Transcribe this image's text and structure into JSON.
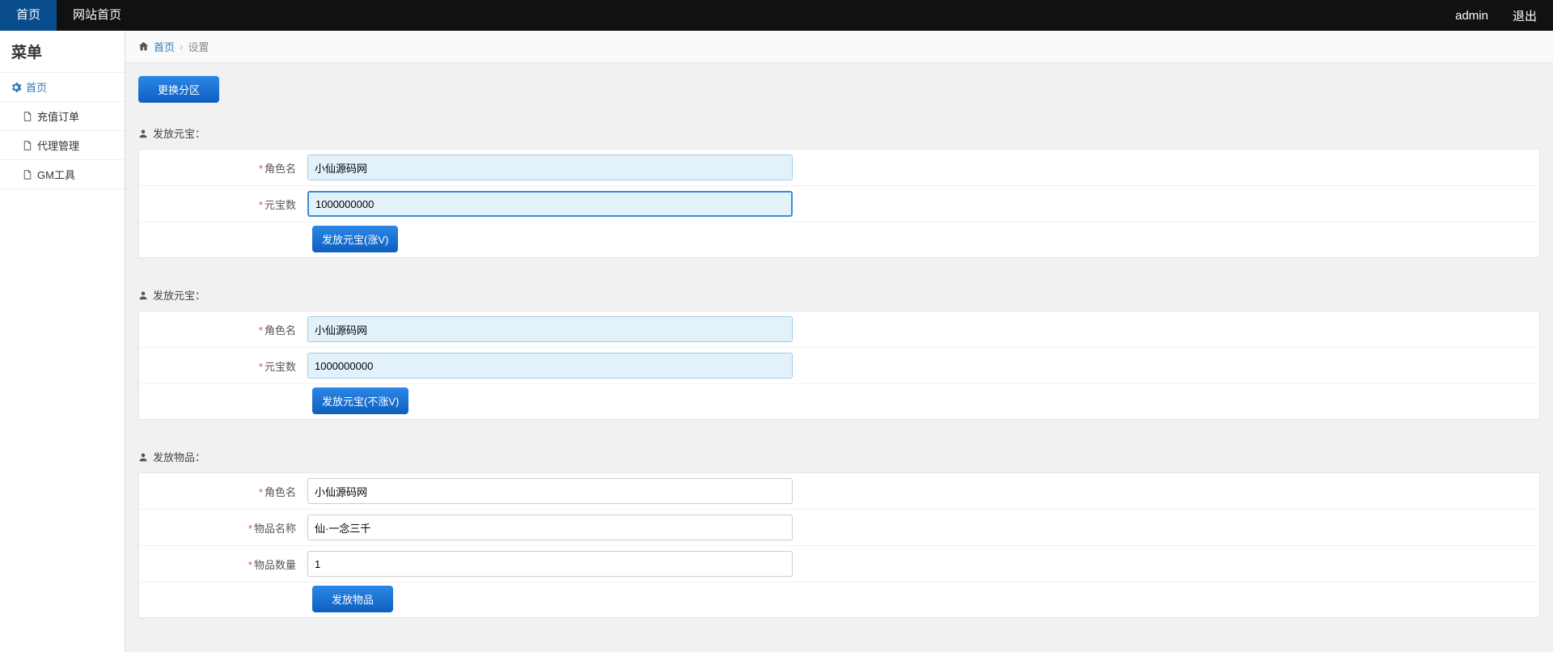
{
  "topbar": {
    "tab_home": "首页",
    "tab_site": "网站首页",
    "user": "admin",
    "logout": "退出"
  },
  "sidebar": {
    "title": "菜单",
    "home": "首页",
    "items": [
      "充值订单",
      "代理管理",
      "GM工具"
    ]
  },
  "breadcrumb": {
    "home": "首页",
    "current": "设置"
  },
  "topButton": "更换分区",
  "section1": {
    "title": "发放元宝：",
    "role_label": "角色名",
    "role_value": "小仙源码网",
    "count_label": "元宝数",
    "count_value": "1000000000",
    "button": "发放元宝(涨V)"
  },
  "section2": {
    "title": "发放元宝：",
    "role_label": "角色名",
    "role_value": "小仙源码网",
    "count_label": "元宝数",
    "count_value": "1000000000",
    "button": "发放元宝(不涨V)"
  },
  "section3": {
    "title": "发放物品：",
    "role_label": "角色名",
    "role_value": "小仙源码网",
    "item_label": "物品名称",
    "item_value": "仙·一念三千",
    "qty_label": "物品数量",
    "qty_value": "1",
    "button": "发放物品"
  }
}
